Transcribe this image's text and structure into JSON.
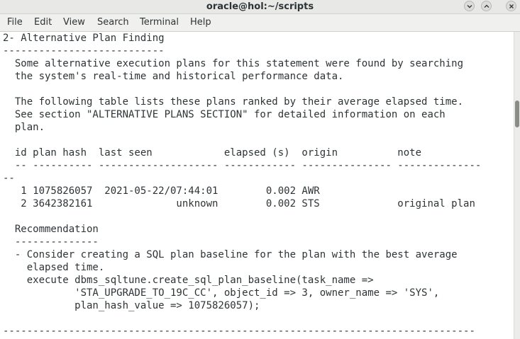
{
  "window": {
    "title": "oracle@hol:~/scripts",
    "buttons": {
      "minimize": "chevron-down-icon",
      "maximize": "chevron-up-icon",
      "close": "close-icon"
    }
  },
  "menubar": {
    "items": [
      "File",
      "Edit",
      "View",
      "Search",
      "Terminal",
      "Help"
    ]
  },
  "terminal": {
    "lines": [
      "2- Alternative Plan Finding",
      "---------------------------",
      "  Some alternative execution plans for this statement were found by searching",
      "  the system's real-time and historical performance data.",
      "",
      "  The following table lists these plans ranked by their average elapsed time.",
      "  See section \"ALTERNATIVE PLANS SECTION\" for detailed information on each",
      "  plan.",
      "",
      "  id plan hash  last seen            elapsed (s)  origin          note",
      "  -- ---------- -------------------- ------------ --------------- --------------",
      "--",
      "   1 1075826057  2021-05-22/07:44:01        0.002 AWR",
      "   2 3642382161              unknown        0.002 STS             original plan",
      "",
      "  Recommendation",
      "  --------------",
      "  - Consider creating a SQL plan baseline for the plan with the best average",
      "    elapsed time.",
      "    execute dbms_sqltune.create_sql_plan_baseline(task_name =>",
      "            'STA_UPGRADE_TO_19C_CC', object_id => 3, owner_name => 'SYS',",
      "            plan_hash_value => 1075826057);",
      "",
      "-------------------------------------------------------------------------------"
    ]
  },
  "colors": {
    "text": "#2e3436",
    "background": "#ffffff",
    "titlebar": "#e8e8e7",
    "menubar": "#f0f0ef",
    "scroll_thumb": "#8a8c88"
  }
}
